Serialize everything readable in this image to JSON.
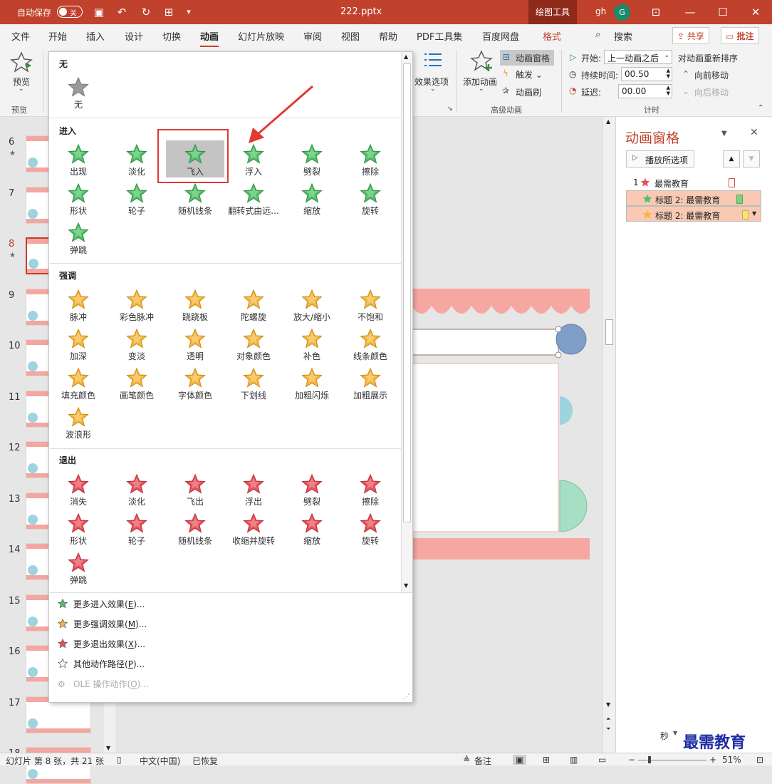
{
  "titlebar": {
    "autosave_label": "自动保存",
    "autosave_state": "关",
    "filename": "222.pptx",
    "drawing_tools": "绘图工具",
    "user": "gh",
    "avatar_letter": "G"
  },
  "menu": {
    "tabs": [
      "文件",
      "开始",
      "插入",
      "设计",
      "切换",
      "动画",
      "幻灯片放映",
      "审阅",
      "视图",
      "帮助",
      "PDF工具集",
      "百度网盘",
      "格式"
    ],
    "active": "动画",
    "search": "搜索",
    "share": "共享",
    "comment": "批注"
  },
  "ribbon": {
    "preview_btn": "预览",
    "preview_group": "预览",
    "effect_options": "效果选项",
    "add_animation": "添加动画",
    "animation_pane": "动画窗格",
    "trigger": "触发",
    "animation_painter": "动画刷",
    "advanced_group": "高级动画",
    "start_label": "开始:",
    "start_value": "上一动画之后",
    "duration_label": "持续时间:",
    "duration_value": "00.50",
    "delay_label": "延迟:",
    "delay_value": "00.00",
    "timing_group": "计时",
    "reorder_title": "对动画重新排序",
    "move_earlier": "向前移动",
    "move_later": "向后移动"
  },
  "slides": [
    {
      "num": "6",
      "star": "★"
    },
    {
      "num": "7",
      "star": ""
    },
    {
      "num": "8",
      "star": "★"
    },
    {
      "num": "9",
      "star": ""
    },
    {
      "num": "10",
      "star": ""
    },
    {
      "num": "11",
      "star": ""
    },
    {
      "num": "12",
      "star": ""
    },
    {
      "num": "13",
      "star": ""
    },
    {
      "num": "14",
      "star": ""
    },
    {
      "num": "15",
      "star": ""
    },
    {
      "num": "16",
      "star": ""
    },
    {
      "num": "17",
      "star": ""
    },
    {
      "num": "18",
      "star": ""
    }
  ],
  "gallery": {
    "none_title": "无",
    "none_item": "无",
    "entrance_title": "进入",
    "entrance": [
      "出现",
      "淡化",
      "飞入",
      "浮入",
      "劈裂",
      "擦除",
      "形状",
      "轮子",
      "随机线条",
      "翻转式由远...",
      "缩放",
      "旋转",
      "弹跳"
    ],
    "emphasis_title": "强调",
    "emphasis": [
      "脉冲",
      "彩色脉冲",
      "跷跷板",
      "陀螺旋",
      "放大/缩小",
      "不饱和",
      "加深",
      "变淡",
      "透明",
      "对象颜色",
      "补色",
      "线条颜色",
      "填充颜色",
      "画笔颜色",
      "字体颜色",
      "下划线",
      "加粗闪烁",
      "加粗展示",
      "波浪形"
    ],
    "exit_title": "退出",
    "exit": [
      "消失",
      "淡化",
      "飞出",
      "浮出",
      "劈裂",
      "擦除",
      "形状",
      "轮子",
      "随机线条",
      "收缩并旋转",
      "缩放",
      "旋转",
      "弹跳"
    ],
    "more": [
      {
        "pre": "更多进入效果(",
        "key": "E",
        "post": ")..."
      },
      {
        "pre": "更多强调效果(",
        "key": "M",
        "post": ")..."
      },
      {
        "pre": "更多退出效果(",
        "key": "X",
        "post": ")..."
      },
      {
        "pre": "其他动作路径(",
        "key": "P",
        "post": ")..."
      },
      {
        "pre": "OLE 操作动作(",
        "key": "O",
        "post": ")..."
      }
    ]
  },
  "anim_pane": {
    "title": "动画窗格",
    "play_button": "播放所选项",
    "items": [
      {
        "index": "1",
        "label": "最需教育"
      },
      {
        "index": "",
        "label": "标题 2: 最需教育"
      },
      {
        "index": "",
        "label": "标题 2: 最需教育"
      }
    ],
    "seconds": "秒"
  },
  "statusbar": {
    "slide_info": "幻灯片 第 8 张，共 21 张",
    "language": "中文(中国)",
    "recovered": "已恢复",
    "notes": "备注",
    "zoom": "51%"
  },
  "watermark": "最需教育",
  "colors": {
    "brand": "#c0412c",
    "entrance_star": "#4fbf68",
    "emphasis_star": "#f5b63c",
    "exit_star": "#e8505b",
    "highlight_box": "#e03a32"
  }
}
